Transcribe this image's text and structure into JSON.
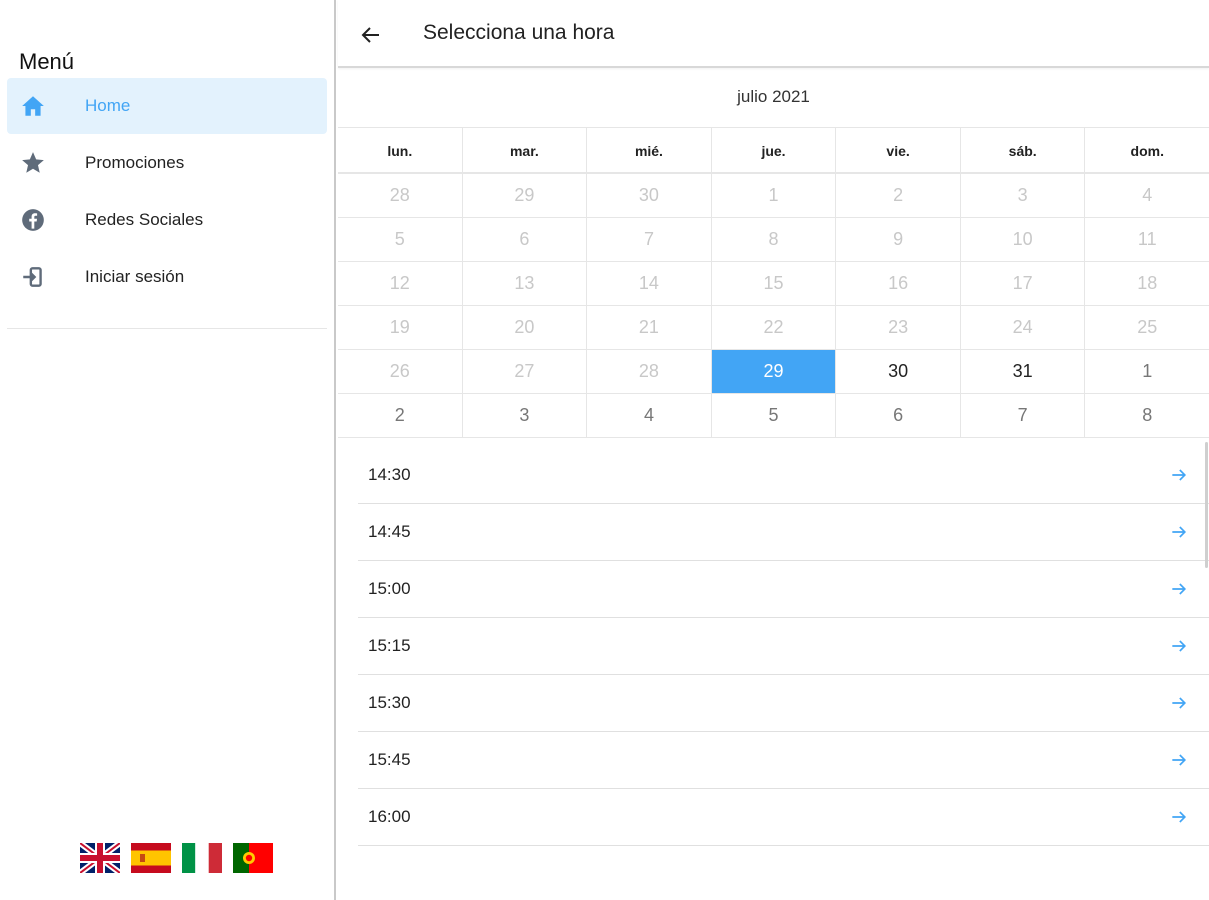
{
  "sidebar": {
    "title": "Menú",
    "items": [
      {
        "label": "Home",
        "icon": "home-icon",
        "active": true
      },
      {
        "label": "Promociones",
        "icon": "star-icon",
        "active": false
      },
      {
        "label": "Redes Sociales",
        "icon": "facebook-icon",
        "active": false
      },
      {
        "label": "Iniciar sesión",
        "icon": "login-icon",
        "active": false
      }
    ],
    "flags": [
      "uk-flag",
      "spain-flag",
      "italy-flag",
      "portugal-flag"
    ]
  },
  "header": {
    "title": "Selecciona una hora",
    "back_icon": "arrow-back-icon"
  },
  "calendar": {
    "month_label": "julio 2021",
    "weekdays": [
      "lun.",
      "mar.",
      "mié.",
      "jue.",
      "vie.",
      "sáb.",
      "dom."
    ],
    "weeks": [
      [
        "28",
        "29",
        "30",
        "1",
        "2",
        "3",
        "4"
      ],
      [
        "5",
        "6",
        "7",
        "8",
        "9",
        "10",
        "11"
      ],
      [
        "12",
        "13",
        "14",
        "15",
        "16",
        "17",
        "18"
      ],
      [
        "19",
        "20",
        "21",
        "22",
        "23",
        "24",
        "25"
      ],
      [
        "26",
        "27",
        "28",
        "29",
        "30",
        "31",
        "1"
      ],
      [
        "2",
        "3",
        "4",
        "5",
        "6",
        "7",
        "8"
      ]
    ],
    "selected": "29",
    "accent_color": "#42a5f5"
  },
  "times": {
    "slots": [
      "14:30",
      "14:45",
      "15:00",
      "15:15",
      "15:30",
      "15:45",
      "16:00"
    ],
    "arrow_icon": "arrow-forward-icon"
  },
  "colors": {
    "accent": "#42a5f5",
    "active_bg": "#e3f2fd",
    "icon_gray": "#5f6b7a"
  }
}
